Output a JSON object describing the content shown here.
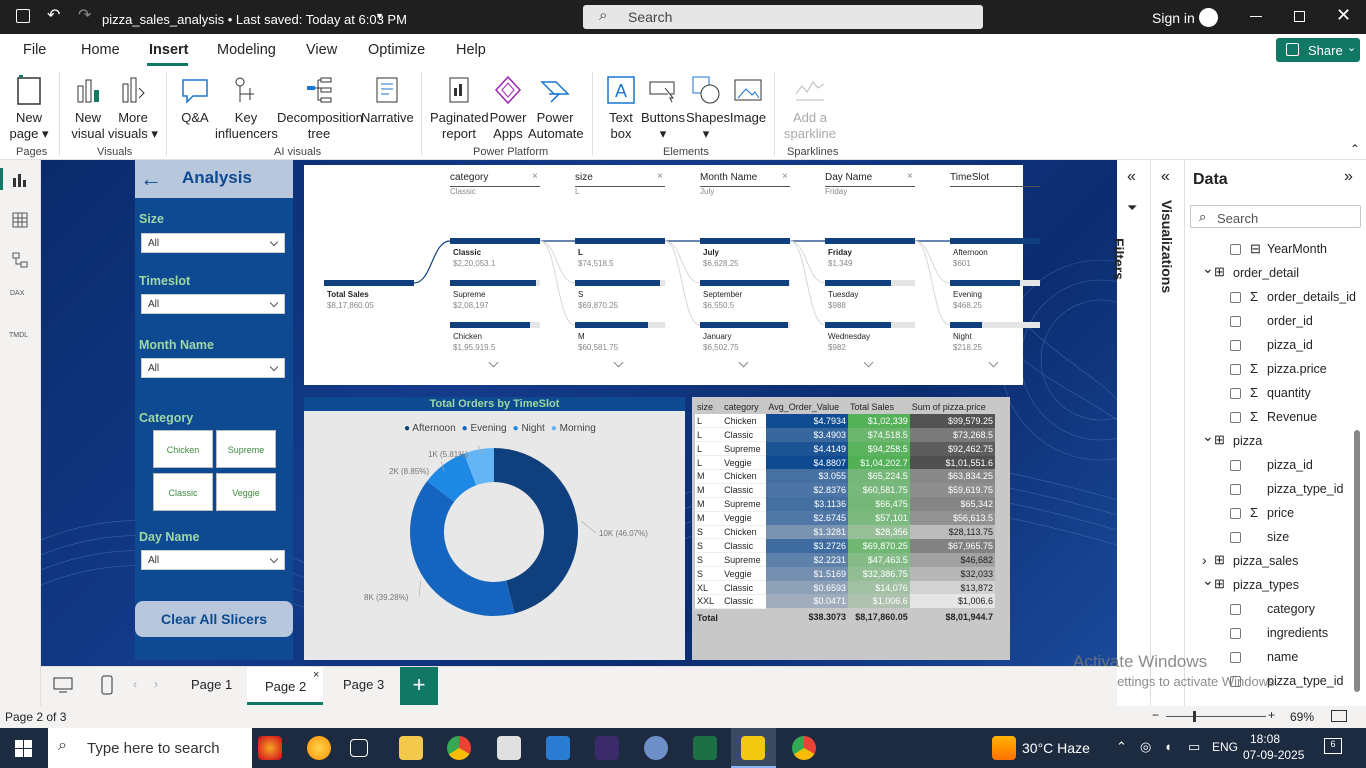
{
  "titlebar": {
    "doc_title": "pizza_sales_analysis  •  Last saved: Today at 6:03 PM",
    "search": "Search",
    "signin": "Sign in"
  },
  "menu": [
    "File",
    "Home",
    "Insert",
    "Modeling",
    "View",
    "Optimize",
    "Help"
  ],
  "share": "Share",
  "ribbon": {
    "buttons": [
      "New page",
      "New visual",
      "More visuals",
      "Q&A",
      "Key influencers",
      "Decomposition tree",
      "Narrative",
      "Paginated report",
      "Power Apps",
      "Power Automate",
      "Text box",
      "Buttons",
      "Shapes",
      "Image",
      "Add a sparkline"
    ],
    "groups": [
      "Pages",
      "Visuals",
      "AI visuals",
      "Power Platform",
      "Elements",
      "Sparklines"
    ]
  },
  "slicers": {
    "header": "Analysis",
    "size_label": "Size",
    "size_value": "All",
    "timeslot_label": "Timeslot",
    "timeslot_value": "All",
    "month_label": "Month Name",
    "month_value": "All",
    "category_label": "Category",
    "categories": [
      "Chicken",
      "Supreme",
      "Classic",
      "Veggie"
    ],
    "day_label": "Day Name",
    "day_value": "All",
    "clear": "Clear All Slicers"
  },
  "decomp": {
    "heads": [
      {
        "t": "category",
        "s": "Classic"
      },
      {
        "t": "size",
        "s": "L"
      },
      {
        "t": "Month Name",
        "s": "July"
      },
      {
        "t": "Day Name",
        "s": "Friday"
      },
      {
        "t": "TimeSlot",
        "s": ""
      }
    ],
    "root": {
      "name": "Total Sales",
      "value": "$8,17,860.05"
    },
    "cols": [
      [
        {
          "n": "Classic",
          "v": "$2,20,053.1",
          "sel": true,
          "p": 1.0
        },
        {
          "n": "Supreme",
          "v": "$2,08,197",
          "p": 0.95
        },
        {
          "n": "Chicken",
          "v": "$1,95,919.5",
          "p": 0.89
        }
      ],
      [
        {
          "n": "L",
          "v": "$74,518.5",
          "sel": true,
          "p": 1.0
        },
        {
          "n": "S",
          "v": "$69,870.25",
          "p": 0.94
        },
        {
          "n": "M",
          "v": "$60,581.75",
          "p": 0.81
        }
      ],
      [
        {
          "n": "July",
          "v": "$6,628.25",
          "sel": true,
          "p": 1.0
        },
        {
          "n": "September",
          "v": "$6,550.5",
          "p": 0.99
        },
        {
          "n": "January",
          "v": "$6,502.75",
          "p": 0.98
        }
      ],
      [
        {
          "n": "Friday",
          "v": "$1,349",
          "sel": true,
          "p": 1.0
        },
        {
          "n": "Tuesday",
          "v": "$988",
          "p": 0.73
        },
        {
          "n": "Wednesday",
          "v": "$982",
          "p": 0.73
        }
      ],
      [
        {
          "n": "Afternoon",
          "v": "$601",
          "p": 1.0
        },
        {
          "n": "Evening",
          "v": "$468.25",
          "p": 0.78
        },
        {
          "n": "Night",
          "v": "$218.25",
          "p": 0.36
        }
      ]
    ]
  },
  "chart_data": {
    "type": "pie",
    "title": "Total Orders by TimeSlot",
    "legend": [
      "Afternoon",
      "Evening",
      "Night",
      "Morning"
    ],
    "legend_position": "top",
    "slices": [
      {
        "name": "Afternoon",
        "value": 10000,
        "label": "10K (46.07%)",
        "pct": 46.07,
        "color": "#0f3f7d"
      },
      {
        "name": "Evening",
        "value": 8000,
        "label": "8K (39.28%)",
        "pct": 39.28,
        "color": "#1565c0"
      },
      {
        "name": "Night",
        "value": 2000,
        "label": "2K (8.85%)",
        "pct": 8.85,
        "color": "#1e88e5"
      },
      {
        "name": "Morning",
        "value": 1000,
        "label": "1K (5.81%)",
        "pct": 5.81,
        "color": "#64b5f6"
      }
    ]
  },
  "table": {
    "headers": [
      "size",
      "category",
      "Avg_Order_Value",
      "Total Sales",
      "Sum of pizza.price"
    ],
    "rows": [
      [
        "L",
        "Chicken",
        "$4.7934",
        "$1,02,339",
        "$99,579.25"
      ],
      [
        "L",
        "Classic",
        "$3.4903",
        "$74,518.5",
        "$73,268.5"
      ],
      [
        "L",
        "Supreme",
        "$4.4149",
        "$94,258.5",
        "$92,462.75"
      ],
      [
        "L",
        "Veggie",
        "$4.8807",
        "$1,04,202.7",
        "$1,01,551.6"
      ],
      [
        "M",
        "Chicken",
        "$3.055",
        "$65,224.5",
        "$63,834.25"
      ],
      [
        "M",
        "Classic",
        "$2.8376",
        "$60,581.75",
        "$59,619.75"
      ],
      [
        "M",
        "Supreme",
        "$3.1136",
        "$66,475",
        "$65,342"
      ],
      [
        "M",
        "Veggie",
        "$2.6745",
        "$57,101",
        "$56,613.5"
      ],
      [
        "S",
        "Chicken",
        "$1.3281",
        "$28,356",
        "$28,113.75"
      ],
      [
        "S",
        "Classic",
        "$3.2726",
        "$69,870.25",
        "$67,965.75"
      ],
      [
        "S",
        "Supreme",
        "$2.2231",
        "$47,463.5",
        "$46,682"
      ],
      [
        "S",
        "Veggie",
        "$1.5169",
        "$32,386.75",
        "$32,033"
      ],
      [
        "XL",
        "Classic",
        "$0.6593",
        "$14,076",
        "$13,872"
      ],
      [
        "XXL",
        "Classic",
        "$0.0471",
        "$1,006.6",
        "$1,006.6"
      ]
    ],
    "total": [
      "Total",
      "",
      "$38.3073",
      "$8,17,860.05",
      "$8,01,944.7"
    ]
  },
  "panes": {
    "filters": "Filters",
    "visualizations": "Visualizations",
    "data_title": "Data",
    "search": "Search"
  },
  "fields": [
    {
      "lvl": 2,
      "name": "YearMonth",
      "icon": "hierarchy"
    },
    {
      "lvl": 1,
      "name": "order_detail",
      "icon": "table",
      "open": true
    },
    {
      "lvl": 2,
      "name": "order_details_id",
      "icon": "sigma"
    },
    {
      "lvl": 2,
      "name": "order_id",
      "icon": ""
    },
    {
      "lvl": 2,
      "name": "pizza_id",
      "icon": ""
    },
    {
      "lvl": 2,
      "name": "pizza.price",
      "icon": "sigma"
    },
    {
      "lvl": 2,
      "name": "quantity",
      "icon": "sigma"
    },
    {
      "lvl": 2,
      "name": "Revenue",
      "icon": "sigma"
    },
    {
      "lvl": 1,
      "name": "pizza",
      "icon": "table",
      "open": true
    },
    {
      "lvl": 2,
      "name": "pizza_id",
      "icon": ""
    },
    {
      "lvl": 2,
      "name": "pizza_type_id",
      "icon": ""
    },
    {
      "lvl": 2,
      "name": "price",
      "icon": "sigma"
    },
    {
      "lvl": 2,
      "name": "size",
      "icon": ""
    },
    {
      "lvl": 1,
      "name": "pizza_sales",
      "icon": "table",
      "open": false
    },
    {
      "lvl": 1,
      "name": "pizza_types",
      "icon": "table",
      "open": true
    },
    {
      "lvl": 2,
      "name": "category",
      "icon": ""
    },
    {
      "lvl": 2,
      "name": "ingredients",
      "icon": ""
    },
    {
      "lvl": 2,
      "name": "name",
      "icon": ""
    },
    {
      "lvl": 2,
      "name": "pizza_type_id",
      "icon": ""
    }
  ],
  "pages": [
    "Page 1",
    "Page 2",
    "Page 3"
  ],
  "status": {
    "page": "Page 2 of 3",
    "zoom": "69%"
  },
  "watermark": {
    "line1": "Activate Windows",
    "line2": "Go to Settings to activate Windows."
  },
  "taskbar": {
    "search": "Type here to search",
    "weather": "30°C  Haze",
    "lang": "ENG",
    "time": "18:08",
    "date": "07-09-2025",
    "notif": "6"
  }
}
